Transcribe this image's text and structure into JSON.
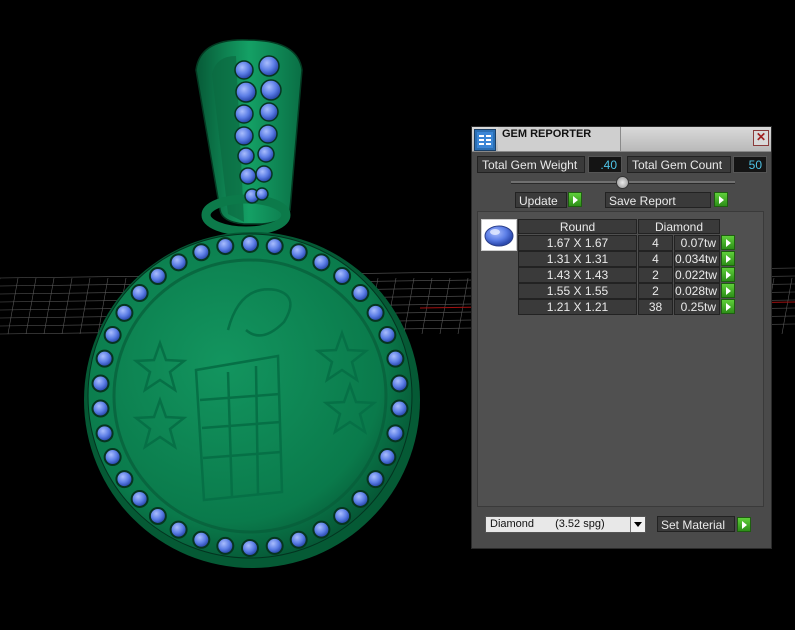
{
  "panel": {
    "title": "GEM REPORTER",
    "close_glyph": "✕",
    "icons": {
      "app": "gem-reporter-icon",
      "close": "close-icon",
      "go": "green-arrow-icon"
    },
    "total_weight_label": "Total Gem Weight",
    "total_weight_value": ".40",
    "total_count_label": "Total Gem Count",
    "total_count_value": "50",
    "update_label": "Update",
    "save_report_label": "Save Report",
    "table": {
      "headers": [
        "Round",
        "Diamond"
      ],
      "rows": [
        {
          "size": "1.67 X 1.67",
          "count": "4",
          "weight": "0.07tw"
        },
        {
          "size": "1.31 X 1.31",
          "count": "4",
          "weight": "0.034tw"
        },
        {
          "size": "1.43 X 1.43",
          "count": "2",
          "weight": "0.022tw"
        },
        {
          "size": "1.55 X 1.55",
          "count": "2",
          "weight": "0.028tw"
        },
        {
          "size": "1.21 X 1.21",
          "count": "38",
          "weight": "0.25tw"
        }
      ]
    },
    "material": {
      "name": "Diamond",
      "spg": "(3.52 spg)"
    },
    "set_material_label": "Set Material"
  },
  "colors": {
    "model": "#0f8a56",
    "gem": "#5577e0",
    "value_text": "#4ec3e6",
    "go_button": "#3fae24"
  }
}
